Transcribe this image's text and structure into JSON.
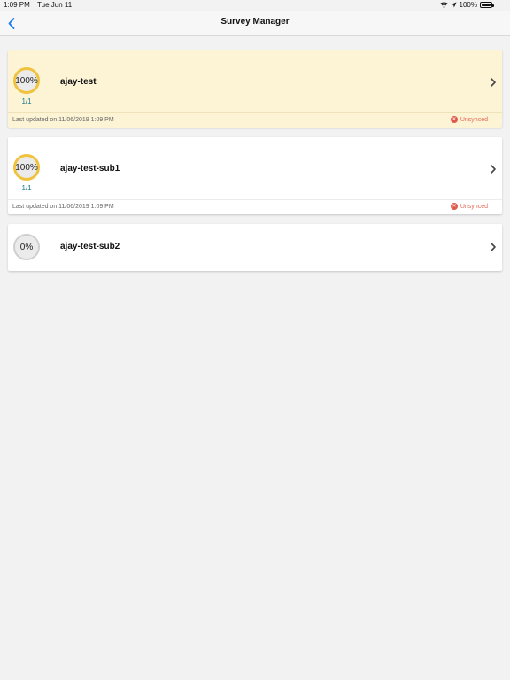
{
  "status_bar": {
    "time": "1:09 PM",
    "date": "Tue Jun 11",
    "battery": "100%"
  },
  "nav": {
    "title": "Survey Manager"
  },
  "surveys": [
    {
      "progress": "100%",
      "fraction": "1/1",
      "name": "ajay-test",
      "updated": "Last updated on 11/06/2019 1:09 PM",
      "sync": "Unsynced"
    },
    {
      "progress": "100%",
      "fraction": "1/1",
      "name": "ajay-test-sub1",
      "updated": "Last updated on 11/06/2019 1:09 PM",
      "sync": "Unsynced"
    },
    {
      "progress": "0%",
      "name": "ajay-test-sub2"
    }
  ],
  "colors": {
    "accent": "#1a7cf5",
    "ring_full": "#f0c23e",
    "highlight_bg": "#fdf4d6",
    "unsynced": "#e05a4c",
    "fraction": "#1b7a8f"
  }
}
